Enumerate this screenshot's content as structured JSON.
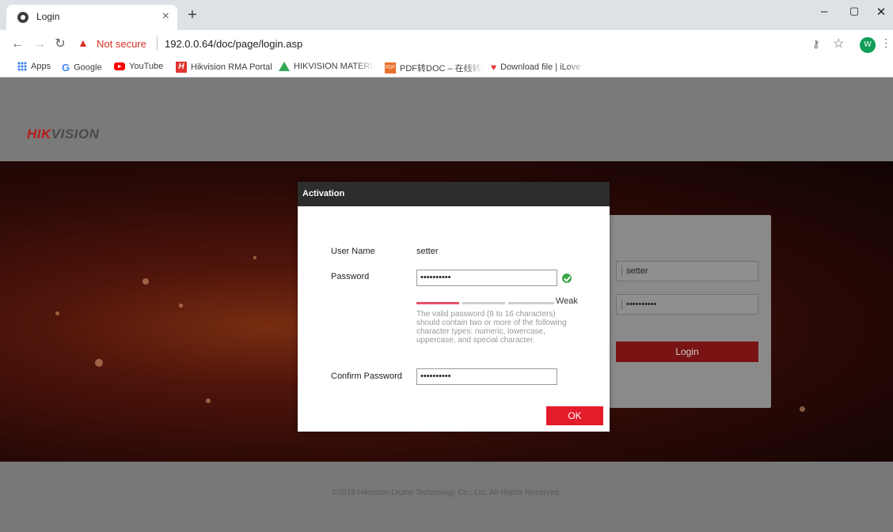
{
  "browser": {
    "tab_title": "Login",
    "tab_close": "×",
    "new_tab": "+",
    "window_controls": [
      "–",
      "▢",
      "✕"
    ],
    "not_secure": "Not secure",
    "url": "192.0.0.64/doc/page/login.asp",
    "avatar_initial": "W",
    "bookmarks": [
      {
        "label": "Apps",
        "icon": "apps-grid-icon"
      },
      {
        "label": "Google",
        "icon": "google-icon"
      },
      {
        "label": "YouTube",
        "icon": "youtube-icon"
      },
      {
        "label": "Hikvision RMA Portal",
        "icon": "hikvision-icon"
      },
      {
        "label": "HIKVISION MATERIAL",
        "icon": "drive-icon"
      },
      {
        "label": "PDF转DOC – 在线转换",
        "icon": "pdf-icon"
      },
      {
        "label": "Download file | iLove",
        "icon": "heart-icon"
      }
    ]
  },
  "page": {
    "logo_red": "HIK",
    "logo_grey": "VISION",
    "copyright": "©2019 Hikvision Digital Technology Co., Ltd. All Rights Reserved.",
    "login_panel": {
      "username_value": "setter",
      "password_value": "••••••••••",
      "login_button": "Login"
    }
  },
  "activation_dialog": {
    "title": "Activation",
    "user_name_label": "User Name",
    "user_name_value": "setter",
    "password_label": "Password",
    "password_value": "••••••••••",
    "strength_label": "Weak",
    "strength_level": 1,
    "strength_levels_total": 3,
    "hint": "The valid password (8 to 16 characters) should contain two or more of the following character types: numeric, lowercase, uppercase, and special character.",
    "confirm_password_label": "Confirm Password",
    "confirm_password_value": "••••••••••",
    "ok_button": "OK"
  },
  "colors": {
    "accent_red": "#e31c2c",
    "strength_active": "#e8506a",
    "strength_inactive": "#cfcfcf",
    "valid_green": "#3aa84a"
  }
}
